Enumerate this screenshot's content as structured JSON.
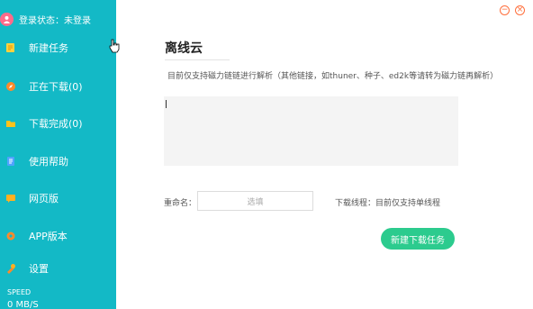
{
  "sidebar": {
    "login_status": "登录状态：未登录",
    "items": [
      {
        "label": "新建任务",
        "icon": "edit-icon"
      },
      {
        "label": "正在下载(0)",
        "icon": "compass-icon"
      },
      {
        "label": "下载完成(0)",
        "icon": "folder-icon"
      },
      {
        "label": "使用帮助",
        "icon": "document-icon"
      },
      {
        "label": "网页版",
        "icon": "chat-icon"
      },
      {
        "label": "APP版本",
        "icon": "gear-icon"
      },
      {
        "label": "设置",
        "icon": "settings-icon"
      }
    ],
    "speed_label": "SPEED",
    "speed_value": "0 MB/S"
  },
  "window": {
    "minimize": "−",
    "close": "×"
  },
  "main": {
    "title": "离线云",
    "hint": "目前仅支持磁力链链进行解析（其他链接，如thuner、种子、ed2k等请转为磁力链再解析）",
    "rename_label": "重命名：",
    "rename_placeholder": "选填",
    "thread_text": "下载线程：目前仅支持单线程",
    "new_task_button": "新建下载任务"
  },
  "colors": {
    "sidebar_bg": "#13b9c6",
    "button_green": "#2ccb8e",
    "control_orange": "#ff6f3c"
  }
}
